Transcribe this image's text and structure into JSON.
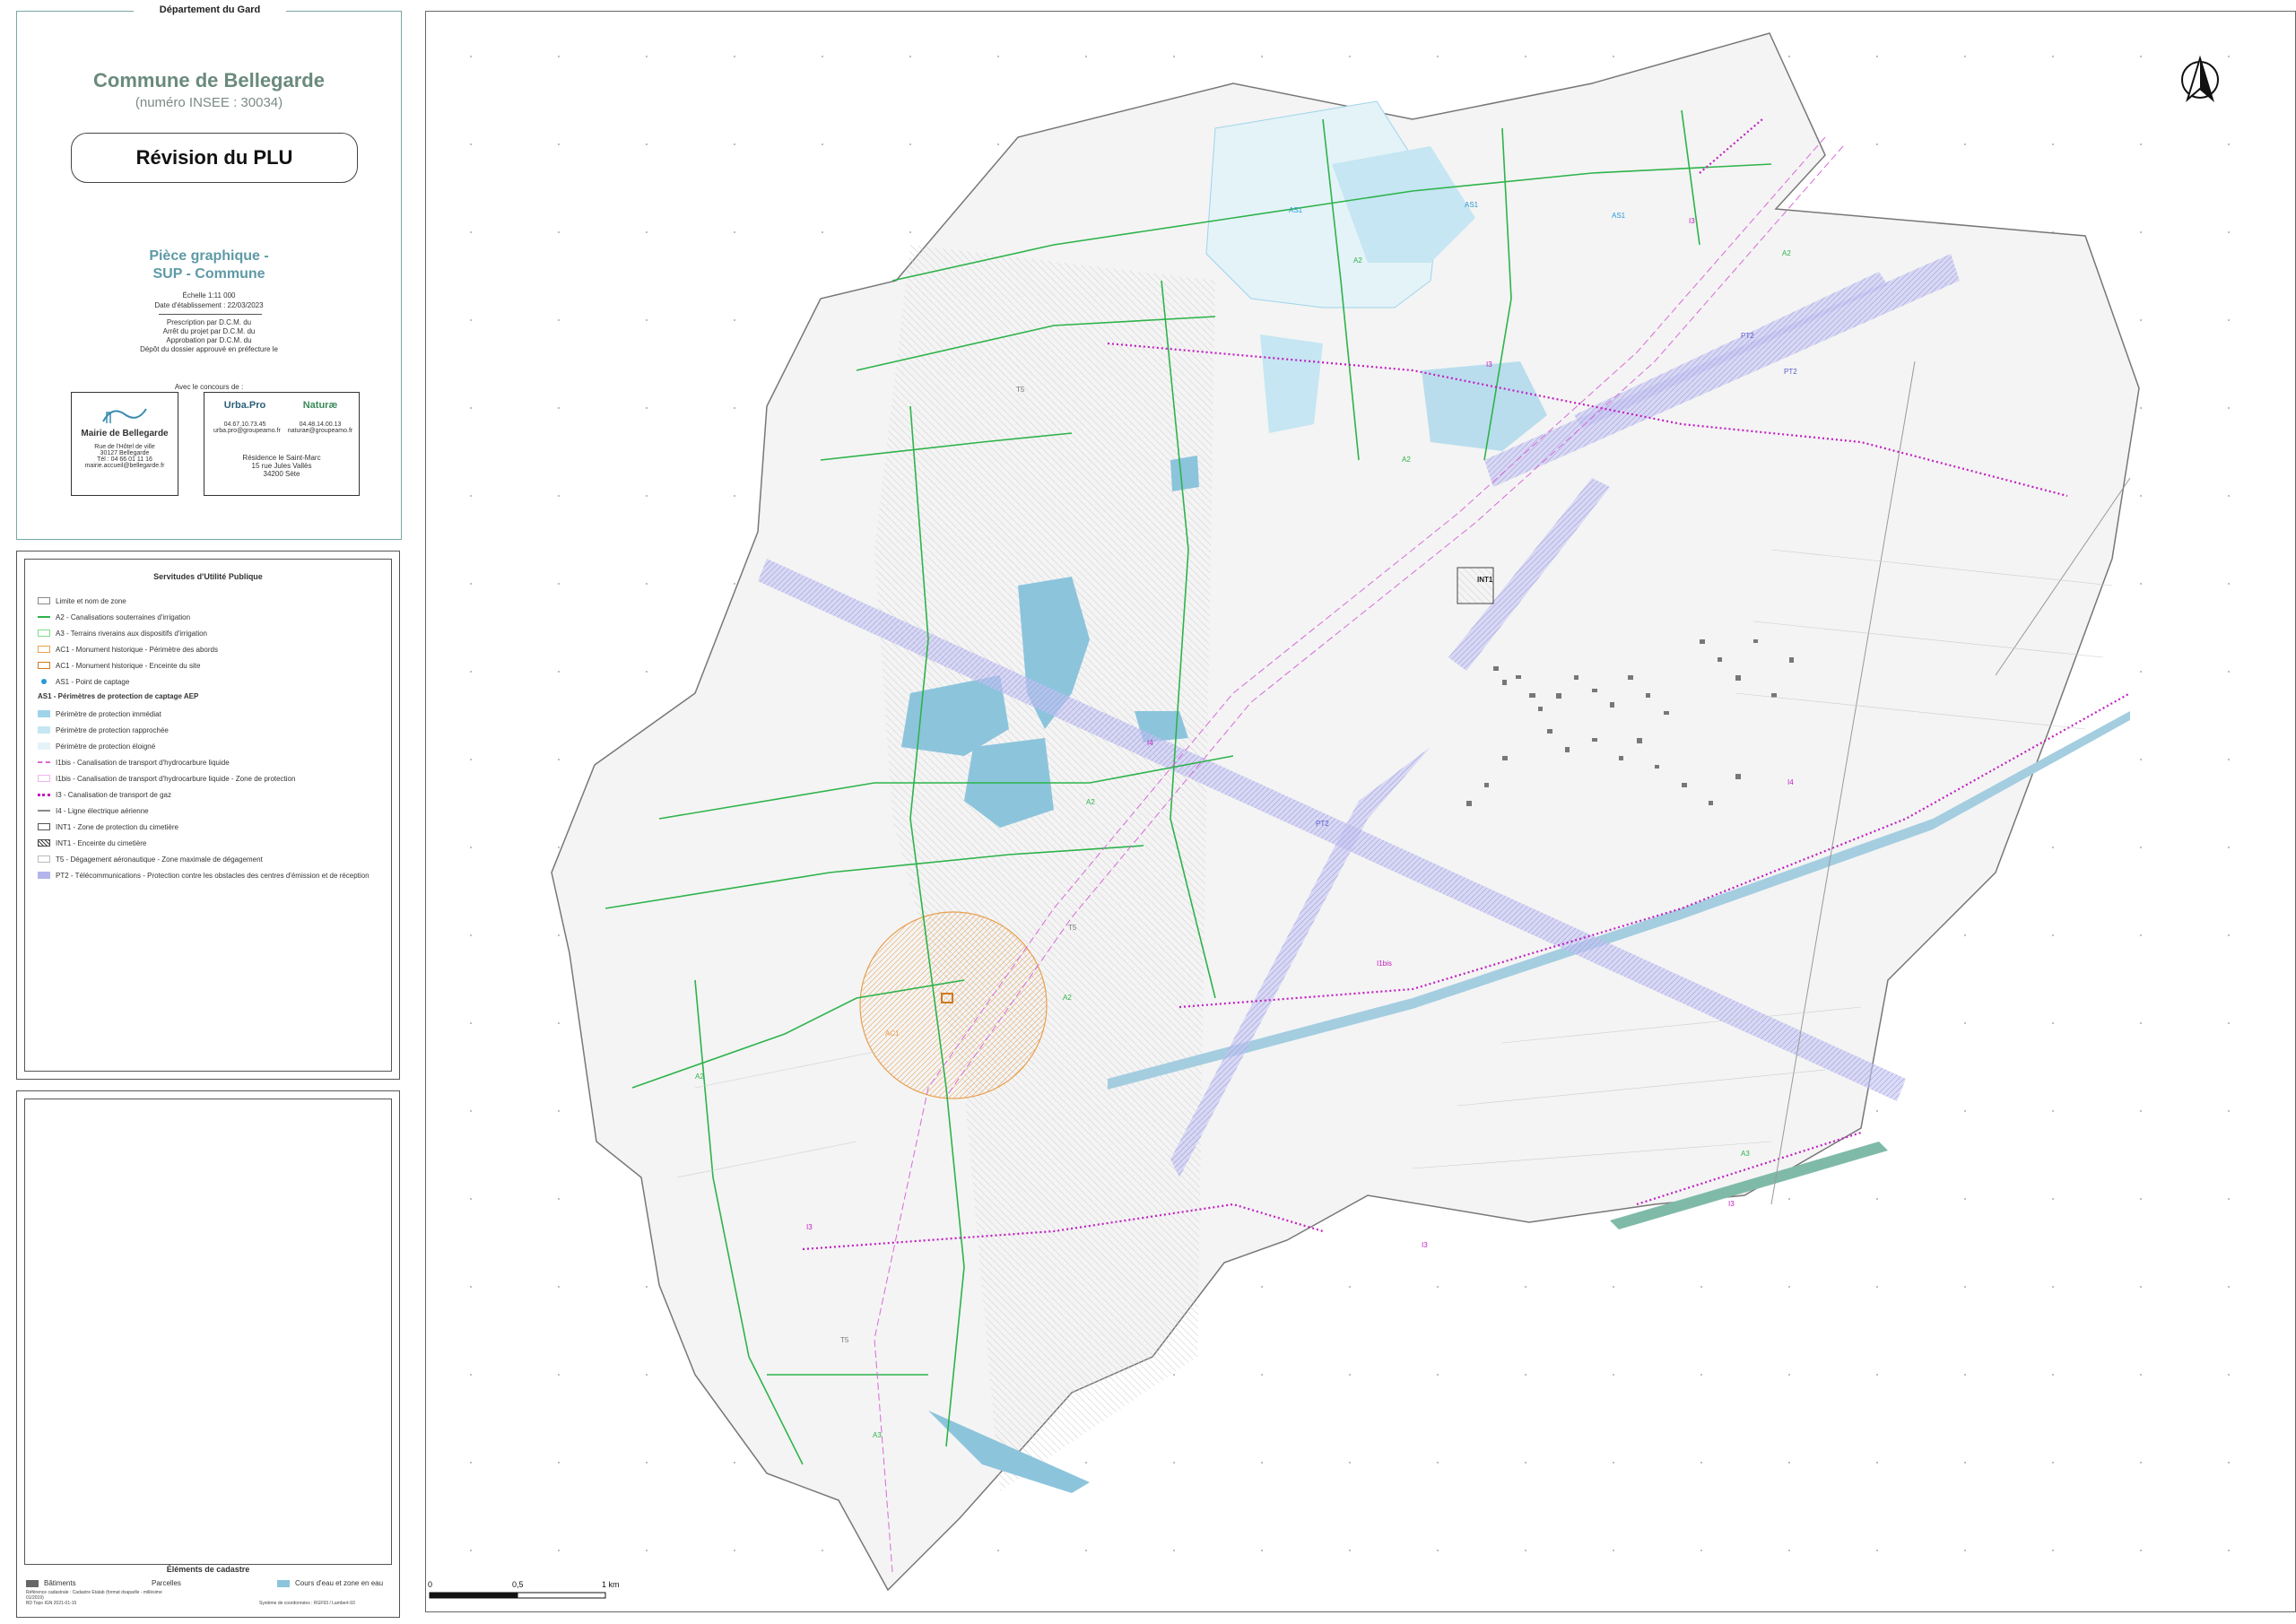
{
  "title_block": {
    "department": "Département du Gard",
    "commune": "Commune de Bellegarde",
    "insee": "(numéro INSEE : 30034)",
    "project": "Révision du PLU",
    "piece_line1": "Pièce graphique -",
    "piece_line2": "SUP - Commune",
    "scale": "Échelle 1:11 000",
    "date": "Date d'établissement : 22/03/2023",
    "procedure": [
      "Prescription par D.C.M. du",
      "Arrêt du projet par D.C.M. du",
      "Approbation par D.C.M. du",
      "Dépôt du dossier approuvé en préfecture le"
    ],
    "partners_label": "Avec le concours de :",
    "mairie": {
      "name": "Mairie de Bellegarde",
      "lines": [
        "Rue de l'Hôtel de ville",
        "30127 Bellegarde",
        "Tél : 04 66 01 11 16",
        "mairie.accueil@bellegarde.fr"
      ]
    },
    "urbapro": {
      "logo": "Urba.Pro",
      "phone": "04.67.10.73.45",
      "email": "urba.pro@groupeamo.fr"
    },
    "naturae": {
      "logo": "Naturæ",
      "phone": "04.48.14.00.13",
      "email": "naturae@groupeamo.fr"
    },
    "address": [
      "Résidence le Saint-Marc",
      "15 rue Jules Vallès",
      "34200 Sète"
    ]
  },
  "legend": {
    "title": "Servitudes d'Utilité Publique",
    "items": [
      {
        "label": "Limite et nom de zone",
        "color": "#888888",
        "style": "box"
      },
      {
        "label": "A2 - Canalisations souterraines d'irrigation",
        "color": "#2db34a",
        "style": "line"
      },
      {
        "label": "A3 - Terrains riverains aux dispositifs d'irrigation",
        "color": "#7fdc8c",
        "style": "box"
      },
      {
        "label": "AC1 - Monument historique - Périmètre des abords",
        "color": "#e8a050",
        "style": "box"
      },
      {
        "label": "AC1 - Monument historique - Enceinte du site",
        "color": "#d07a20",
        "style": "box"
      },
      {
        "label": "AS1 - Point de captage",
        "color": "#2a9ad8",
        "style": "dot"
      },
      {
        "label": "AS1 - Périmètres de protection de captage AEP",
        "color": "#000000",
        "style": "header"
      },
      {
        "label": "Périmètre de protection immédiat",
        "color": "#9fd3ea",
        "style": "fill"
      },
      {
        "label": "Périmètre de protection rapprochée",
        "color": "#c5e6f2",
        "style": "fill"
      },
      {
        "label": "Périmètre de protection éloigné",
        "color": "#e4f3f8",
        "style": "fill"
      },
      {
        "label": "I1bis - Canalisation de transport d'hydrocarbure liquide",
        "color": "#d86ad8",
        "style": "dash"
      },
      {
        "label": "I1bis - Canalisation de transport d'hydrocarbure liquide - Zone de protection",
        "color": "#f0b6f0",
        "style": "box"
      },
      {
        "label": "I3 - Canalisation de transport de gaz",
        "color": "#c21ec2",
        "style": "dots"
      },
      {
        "label": "I4 - Ligne électrique aérienne",
        "color": "#888888",
        "style": "line"
      },
      {
        "label": "INT1 - Zone de protection du cimetière",
        "color": "#555555",
        "style": "box"
      },
      {
        "label": "INT1 - Enceinte du cimetière",
        "color": "#444444",
        "style": "hatch"
      },
      {
        "label": "T5 - Dégagement aéronautique - Zone maximale de dégagement",
        "color": "#bbbbbb",
        "style": "box"
      },
      {
        "label": "PT2 - Télécommunications - Protection contre les obstacles des centres d'émission et de réception",
        "color": "#b4b4ec",
        "style": "fill"
      }
    ]
  },
  "cadastre": {
    "title": "Éléments de cadastre",
    "buildings": "Bâtiments",
    "parcels": "Parcelles",
    "water": "Cours d'eau et zone en eau",
    "sources": [
      "Référence cadastrale : Cadastre Etalab (format dxaparlle - millésime",
      "01/2019)",
      "BD Topo IGN 2021-01-15"
    ],
    "crs": "Système de coordonnées : RGF93 / Lambert-93"
  },
  "map": {
    "scalebar": [
      "0",
      "0,5",
      "1 km"
    ],
    "labels": [
      "AS1",
      "AS1",
      "AS1",
      "A2",
      "A2",
      "A2",
      "A2",
      "A2",
      "A2",
      "PT2",
      "PT2",
      "PT2",
      "T5",
      "T5",
      "T5",
      "INT1",
      "I3",
      "I3",
      "I3",
      "I3",
      "I3",
      "I4",
      "I4",
      "I1bis",
      "AC1",
      "A3",
      "A3"
    ]
  },
  "colors": {
    "panel_border": "#7aa5a5",
    "commune_title": "#6a8a7c",
    "piece_title": "#5e9aa6",
    "water": "#8cc4dc",
    "pt2": "#b4b4ec",
    "gas_i3": "#c21ec2",
    "irrigation_a2": "#2db34a"
  }
}
